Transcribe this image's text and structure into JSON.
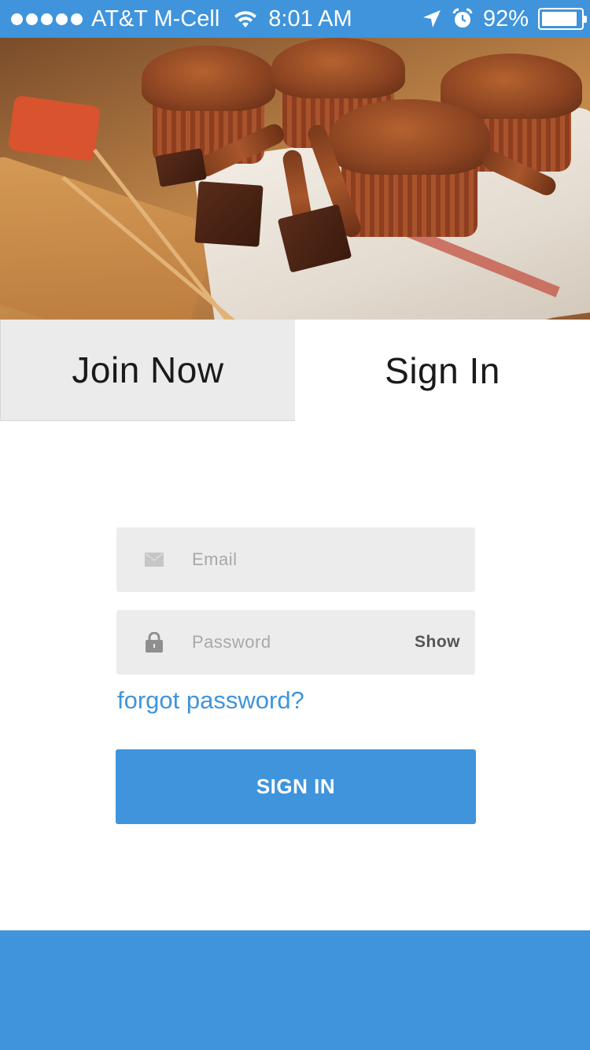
{
  "status_bar": {
    "carrier": "AT&T M-Cell",
    "time": "8:01 AM",
    "battery_percent": "92%",
    "battery_level": 0.92,
    "signal_bars": 5,
    "icons": [
      "signal-dots-icon",
      "wifi-icon",
      "location-arrow-icon",
      "alarm-clock-icon",
      "battery-icon"
    ]
  },
  "hero": {
    "image_alt": ""
  },
  "tabs": [
    {
      "label": "Join Now",
      "active": false
    },
    {
      "label": "Sign In",
      "active": true
    }
  ],
  "form": {
    "email": {
      "placeholder": "Email",
      "value": "",
      "icon": "envelope-icon"
    },
    "password": {
      "placeholder": "Password",
      "value": "",
      "icon": "lock-icon",
      "show_label": "Show"
    },
    "forgot_label": "forgot password?",
    "submit_label": "SIGN IN"
  },
  "colors": {
    "accent": "#3f94db",
    "field_bg": "#ececec",
    "tab_inactive_bg": "#ebebeb"
  }
}
